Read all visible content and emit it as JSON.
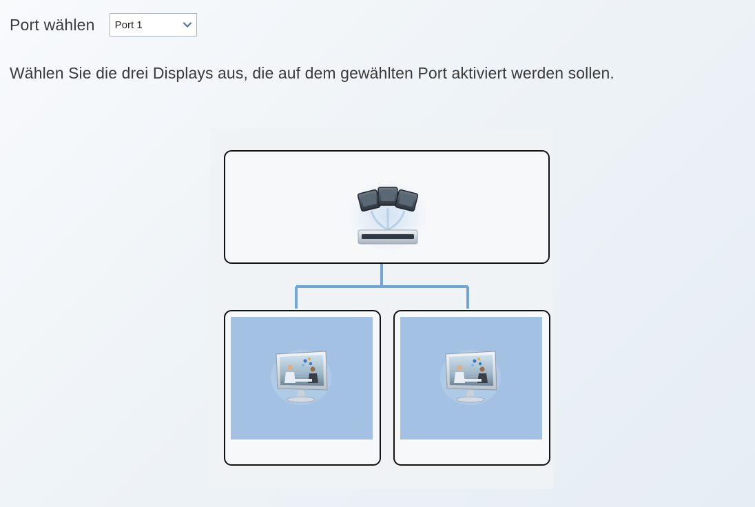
{
  "port": {
    "label": "Port wählen",
    "selected": "Port 1"
  },
  "instructions": "Wählen Sie die drei Displays aus, die auf dem gewählten Port aktiviert werden sollen.",
  "colors": {
    "screen_fill": "#a3c1e3",
    "connector": "#6fa6d6",
    "box_border": "#111111"
  },
  "icons": {
    "hub": "camera-hub-icon",
    "display": "monitor-icon",
    "select_arrow": "chevron-down-icon"
  }
}
